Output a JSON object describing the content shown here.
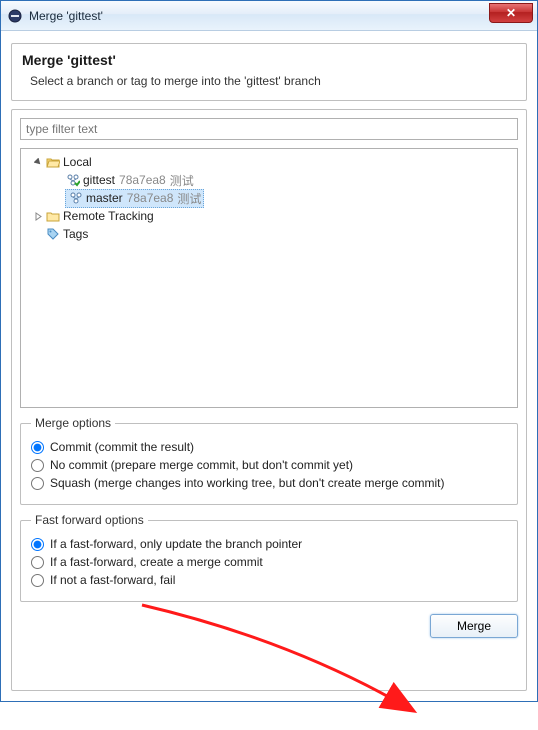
{
  "titlebar": {
    "title": "Merge 'gittest'",
    "close_label": "✕"
  },
  "dialog": {
    "title": "Merge 'gittest'",
    "subtitle": "Select a branch or tag to merge into the 'gittest' branch"
  },
  "filter": {
    "placeholder": "type filter text"
  },
  "tree": {
    "local": {
      "label": "Local",
      "branches": [
        {
          "name": "gittest",
          "hash": "78a7ea8",
          "message": "测试",
          "selected": false,
          "checked_out": true
        },
        {
          "name": "master",
          "hash": "78a7ea8",
          "message": "测试",
          "selected": true,
          "checked_out": false
        }
      ]
    },
    "remote_tracking": {
      "label": "Remote Tracking"
    },
    "tags": {
      "label": "Tags"
    }
  },
  "merge_options": {
    "legend": "Merge options",
    "commit": "Commit (commit the result)",
    "no_commit": "No commit (prepare merge commit, but don't commit yet)",
    "squash": "Squash (merge changes into working tree, but don't create merge commit)"
  },
  "ff_options": {
    "legend": "Fast forward options",
    "ff_only_update": "If a fast-forward, only update the branch pointer",
    "ff_create": "If a fast-forward, create a merge commit",
    "not_ff_fail": "If not a fast-forward, fail"
  },
  "buttons": {
    "merge": "Merge"
  }
}
